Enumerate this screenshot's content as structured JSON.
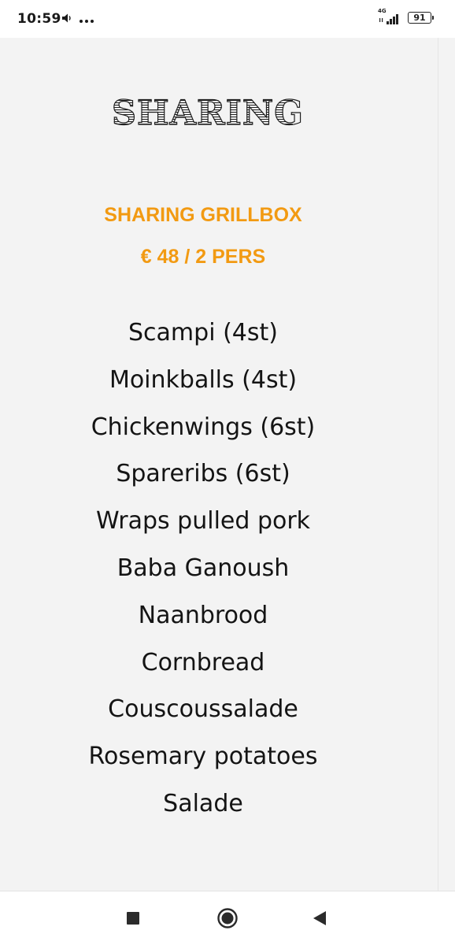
{
  "status_bar": {
    "time": "10:59",
    "network": "4G",
    "battery": "91"
  },
  "content": {
    "title": "SHARING",
    "subtitle": "SHARING GRILLBOX",
    "price": "€ 48 / 2 PERS",
    "items": [
      "Scampi (4st)",
      "Moinkballs (4st)",
      "Chickenwings (6st)",
      "Spareribs (6st)",
      "Wraps pulled pork",
      "Baba Ganoush",
      "Naanbrood",
      "Cornbread",
      "Couscoussalade",
      "Rosemary potatoes",
      "Salade"
    ]
  },
  "colors": {
    "accent": "#f29a12",
    "background": "#f3f3f3",
    "text": "#141414"
  },
  "icons": {
    "status": [
      "volume-icon",
      "more-dots-icon",
      "signal-icon",
      "battery-icon"
    ],
    "nav": [
      "recents-square-icon",
      "home-circle-icon",
      "back-triangle-icon"
    ]
  }
}
